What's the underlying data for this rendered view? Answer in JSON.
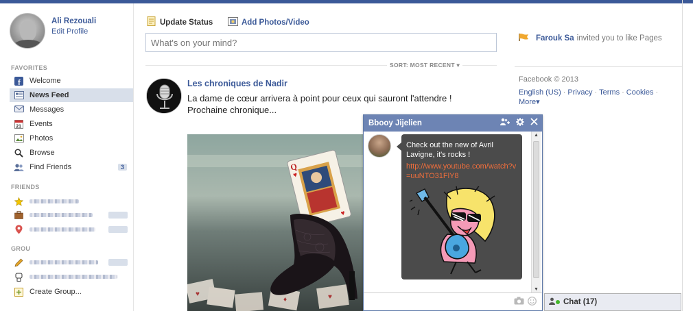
{
  "profile": {
    "name": "Ali Rezouali",
    "edit_label": "Edit Profile"
  },
  "favorites": {
    "heading": "FAVORITES",
    "items": [
      {
        "label": "Welcome",
        "icon": "facebook-icon"
      },
      {
        "label": "News Feed",
        "icon": "news-feed-icon"
      },
      {
        "label": "Messages",
        "icon": "messages-icon"
      },
      {
        "label": "Events",
        "icon": "calendar-icon"
      },
      {
        "label": "Photos",
        "icon": "photos-icon"
      },
      {
        "label": "Browse",
        "icon": "search-icon"
      },
      {
        "label": "Find Friends",
        "icon": "friends-icon",
        "count": "3"
      }
    ]
  },
  "friends": {
    "heading": "FRIENDS"
  },
  "groups": {
    "heading": "GROU",
    "create_label": "Create Group..."
  },
  "composer": {
    "update_status_label": "Update Status",
    "add_photos_label": "Add Photos/Video",
    "placeholder": "What's on your mind?"
  },
  "feed": {
    "sort_label": "SORT: MOST RECENT",
    "post": {
      "author": "Les chroniques de Nadir",
      "text_line1": "La dame de cœur arrivera à point pour ceux qui sauront l'attendre !",
      "text_line2": "Prochaine chronique..."
    }
  },
  "notification": {
    "actor": "Farouk Sa",
    "text": "invited you to like Pages"
  },
  "footer": {
    "copyright": "Facebook © 2013",
    "links": [
      "English (US)",
      "Privacy",
      "Terms",
      "Cookies"
    ],
    "more_label": "More"
  },
  "chat_window": {
    "title": "Bbooy Jijelien",
    "message": "Check out the new of Avril Lavigne, it's rocks !",
    "link": "http://www.youtube.com/watch?v=uuNTO31FlY8"
  },
  "chat_bar": {
    "label": "Chat",
    "count": "(17)"
  },
  "colors": {
    "brand": "#3b5998",
    "chat_header": "#6d84b4",
    "bubble": "#4b4b4b",
    "link_in_bubble": "#f06e3c"
  }
}
